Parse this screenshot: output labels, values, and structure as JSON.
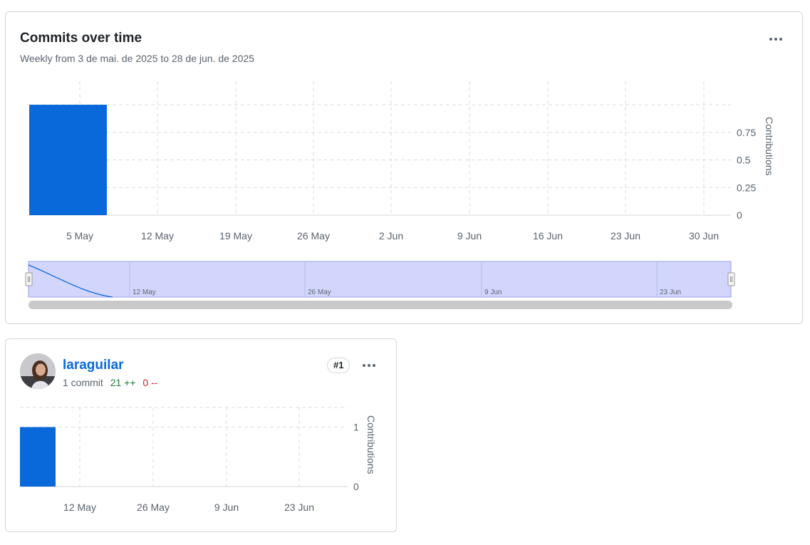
{
  "main_card": {
    "title": "Commits over time",
    "subtitle": "Weekly from 3 de mai. de 2025 to 28 de jun. de 2025",
    "menu_icon": "kebab-horizontal-icon"
  },
  "chart_data": [
    {
      "type": "bar",
      "x_tick_labels": [
        "5 May",
        "12 May",
        "19 May",
        "26 May",
        "2 Jun",
        "9 Jun",
        "16 Jun",
        "23 Jun",
        "30 Jun"
      ],
      "values": [
        1,
        0,
        0,
        0,
        0,
        0,
        0,
        0,
        0
      ],
      "ylabel": "Contributions",
      "y_ticks": [
        "0",
        "0.25",
        "0.5",
        "0.75"
      ],
      "ylim": [
        0,
        1
      ],
      "grid": true,
      "bar_color": "#0969da"
    },
    {
      "type": "area",
      "role": "navigator",
      "tick_labels": [
        "12 May",
        "26 May",
        "9 Jun",
        "23 Jun"
      ],
      "selection": [
        0,
        1
      ],
      "fill_color": "#d3d6fc",
      "line_color": "#0969da"
    },
    {
      "type": "bar",
      "x_tick_labels": [
        "12 May",
        "26 May",
        "9 Jun",
        "23 Jun"
      ],
      "values": [
        1,
        0,
        0,
        0,
        0,
        0,
        0,
        0,
        0
      ],
      "ylabel": "Contributions",
      "y_ticks": [
        "0",
        "1"
      ],
      "ylim": [
        0,
        1.33
      ],
      "grid": true,
      "bar_color": "#0969da"
    }
  ],
  "contributors": [
    {
      "username": "laraguilar",
      "commits": "1 commit",
      "additions": "21 ++",
      "deletions": "0 --",
      "rank": "#1",
      "avatar_icon": "avatar-photo",
      "menu_icon": "kebab-horizontal-icon"
    }
  ]
}
